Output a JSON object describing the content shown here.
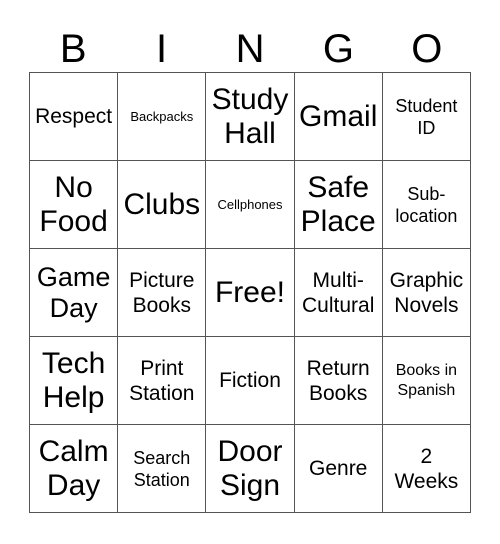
{
  "card": {
    "title": "BINGO",
    "header_letters": [
      "B",
      "I",
      "N",
      "G",
      "O"
    ],
    "border_color": "#555555",
    "text_color": "#000000",
    "background_color": "#ffffff",
    "rows": 5,
    "columns": 5,
    "free_space_label": "Free!",
    "cells": [
      {
        "text": "Respect",
        "size": "fs-md"
      },
      {
        "text": "Backpacks",
        "size": "fs-xxs"
      },
      {
        "text": "Study Hall",
        "size": "fs-xxl"
      },
      {
        "text": "Gmail",
        "size": "fs-xxl"
      },
      {
        "text": "Student ID",
        "size": "fs-sm"
      },
      {
        "text": "No Food",
        "size": "fs-xxl"
      },
      {
        "text": "Clubs",
        "size": "fs-xxl"
      },
      {
        "text": "Cellphones",
        "size": "fs-xxs"
      },
      {
        "text": "Safe Place",
        "size": "fs-xxl"
      },
      {
        "text": "Sub-location",
        "size": "fs-sm"
      },
      {
        "text": "Game Day",
        "size": "fs-xl"
      },
      {
        "text": "Picture Books",
        "size": "fs-md"
      },
      {
        "text": "Free!",
        "size": "fs-xxl"
      },
      {
        "text": "Multi-Cultural",
        "size": "fs-md"
      },
      {
        "text": "Graphic Novels",
        "size": "fs-md"
      },
      {
        "text": "Tech Help",
        "size": "fs-xxl"
      },
      {
        "text": "Print Station",
        "size": "fs-md"
      },
      {
        "text": "Fiction",
        "size": "fs-md"
      },
      {
        "text": "Return Books",
        "size": "fs-md"
      },
      {
        "text": "Books in Spanish",
        "size": "fs-xs"
      },
      {
        "text": "Calm Day",
        "size": "fs-xxl"
      },
      {
        "text": "Search Station",
        "size": "fs-sm"
      },
      {
        "text": "Door Sign",
        "size": "fs-xxl"
      },
      {
        "text": "Genre",
        "size": "fs-md"
      },
      {
        "text": "2 Weeks",
        "size": "fs-md"
      }
    ]
  }
}
